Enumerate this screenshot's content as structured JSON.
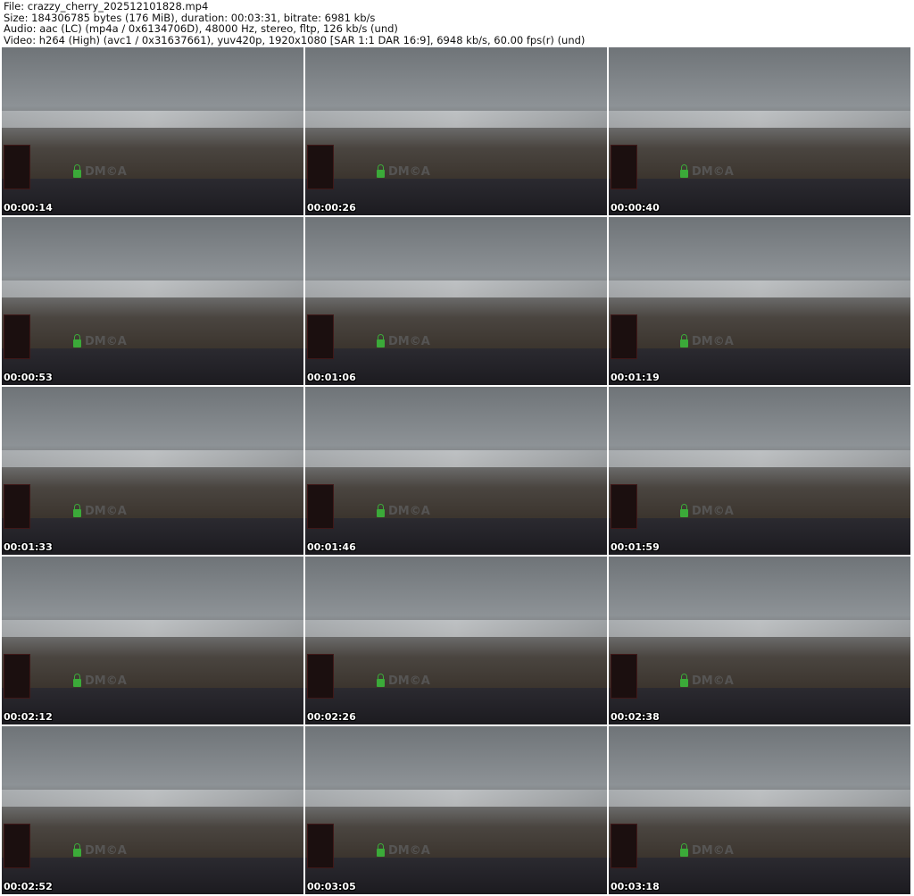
{
  "header": {
    "file": "File: crazzy_cherry_202512101828.mp4",
    "size": "Size: 184306785 bytes (176 MiB), duration: 00:03:31, bitrate: 6981 kb/s",
    "audio": "Audio: aac (LC) (mp4a / 0x6134706D), 48000 Hz, stereo, fltp, 126 kb/s (und)",
    "video": "Video: h264 (High) (avc1 / 0x31637661), yuv420p, 1920x1080 [SAR 1:1 DAR 16:9], 6948 kb/s, 60.00 fps(r) (und)"
  },
  "watermark": "DM©A",
  "thumbnails": [
    {
      "timestamp": "00:00:14"
    },
    {
      "timestamp": "00:00:26"
    },
    {
      "timestamp": "00:00:40"
    },
    {
      "timestamp": "00:00:53"
    },
    {
      "timestamp": "00:01:06"
    },
    {
      "timestamp": "00:01:19"
    },
    {
      "timestamp": "00:01:33"
    },
    {
      "timestamp": "00:01:46"
    },
    {
      "timestamp": "00:01:59"
    },
    {
      "timestamp": "00:02:12"
    },
    {
      "timestamp": "00:02:26"
    },
    {
      "timestamp": "00:02:38"
    },
    {
      "timestamp": "00:02:52"
    },
    {
      "timestamp": "00:03:05"
    },
    {
      "timestamp": "00:03:18"
    }
  ]
}
